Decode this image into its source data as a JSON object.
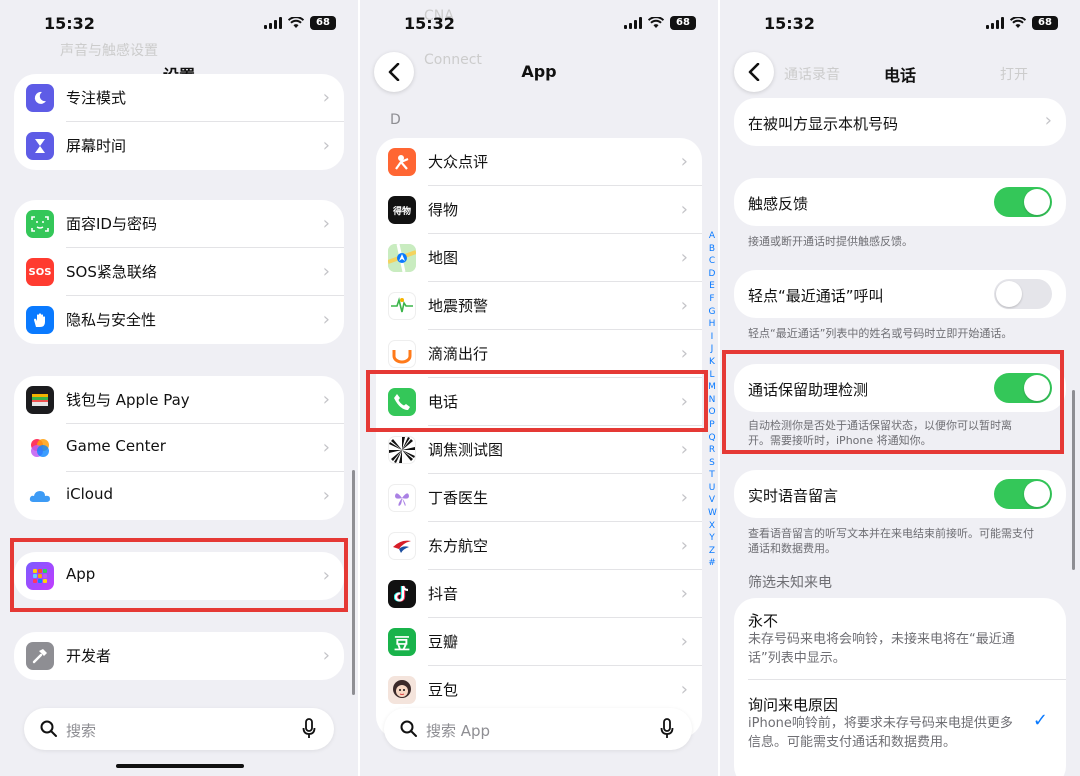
{
  "status_bar": {
    "time": "15:32",
    "battery": "68"
  },
  "panel1": {
    "ghost_top": "声音与触感设置",
    "title": "设置",
    "group1": [
      {
        "label": "专注模式",
        "icon": "moon-icon"
      },
      {
        "label": "屏幕时间",
        "icon": "hourglass-icon"
      }
    ],
    "group2": [
      {
        "label": "面容ID与密码",
        "icon": "faceid-icon"
      },
      {
        "label": "SOS紧急联络",
        "icon": "sos-icon"
      },
      {
        "label": "隐私与安全性",
        "icon": "hand-icon"
      }
    ],
    "group3": [
      {
        "label": "钱包与 Apple Pay",
        "icon": "wallet-icon"
      },
      {
        "label": "Game Center",
        "icon": "game-center-icon"
      },
      {
        "label": "iCloud",
        "icon": "cloud-icon"
      }
    ],
    "group4": [
      {
        "label": "App",
        "icon": "app-grid-icon"
      }
    ],
    "group5": [
      {
        "label": "开发者",
        "icon": "hammer-icon"
      }
    ],
    "sos_text": "SOS",
    "search_placeholder": "搜索"
  },
  "panel2": {
    "ghost_top": "CNA",
    "ghost_top2": "Connect",
    "title": "App",
    "section": "D",
    "apps": [
      {
        "label": "大众点评",
        "icon": "dianping-icon",
        "color": "#ff6633"
      },
      {
        "label": "得物",
        "icon": "dewu-icon",
        "color": "#111111"
      },
      {
        "label": "地图",
        "icon": "maps-icon",
        "color": "#7cc77c"
      },
      {
        "label": "地震预警",
        "icon": "earthquake-icon",
        "color": "#ffffff"
      },
      {
        "label": "滴滴出行",
        "icon": "didi-icon",
        "color": "#ffffff"
      },
      {
        "label": "电话",
        "icon": "phone-icon",
        "color": "#34c759"
      },
      {
        "label": "调焦测试图",
        "icon": "focus-chart-icon",
        "color": "#ffffff"
      },
      {
        "label": "丁香医生",
        "icon": "dxy-icon",
        "color": "#ffffff"
      },
      {
        "label": "东方航空",
        "icon": "ceair-icon",
        "color": "#ffffff"
      },
      {
        "label": "抖音",
        "icon": "douyin-icon",
        "color": "#111111"
      },
      {
        "label": "豆瓣",
        "icon": "douban-icon",
        "color": "#19b34b"
      },
      {
        "label": "豆包",
        "icon": "doubao-icon",
        "color": "#f4e4dc"
      }
    ],
    "dewu_text": "得物",
    "douban_text": "豆",
    "index": [
      "A",
      "B",
      "C",
      "D",
      "E",
      "F",
      "G",
      "H",
      "I",
      "J",
      "K",
      "L",
      "M",
      "N",
      "O",
      "P",
      "Q",
      "R",
      "S",
      "T",
      "U",
      "V",
      "W",
      "X",
      "Y",
      "Z",
      "#"
    ],
    "search_placeholder": "搜索 App"
  },
  "panel3": {
    "title": "电话",
    "ghost_left": "通话录音",
    "ghost_right": "打开",
    "show_number": "在被叫方显示本机号码",
    "haptics": {
      "label": "触感反馈",
      "on": true,
      "note": "接通或断开通话时提供触感反馈。"
    },
    "tap_recents": {
      "label": "轻点“最近通话”呼叫",
      "on": false,
      "note": "轻点“最近通话”列表中的姓名或号码时立即开始通话。"
    },
    "hold_assist": {
      "label": "通话保留助理检测",
      "on": true,
      "note": "自动检测你是否处于通话保留状态，以便你可以暂时离开。需要接听时，iPhone 将通知你。"
    },
    "live_voicemail": {
      "label": "实时语音留言",
      "on": true,
      "note": "查看语音留言的听写文本并在来电结束前接听。可能需支付通话和数据费用。"
    },
    "filter_header": "筛选未知来电",
    "never": {
      "label": "永不",
      "desc": "未存号码来电将会响铃，未接来电将在“最近通话”列表中显示。"
    },
    "ask_reason": {
      "label": "询问来电原因",
      "desc": "iPhone响铃前，将要求未存号码来电提供更多信息。可能需支付通话和数据费用。",
      "checked": true
    },
    "check": "✓"
  },
  "colors": {
    "accent": "#0a7aff",
    "toggle_on": "#34c759",
    "highlight": "#e53935"
  }
}
